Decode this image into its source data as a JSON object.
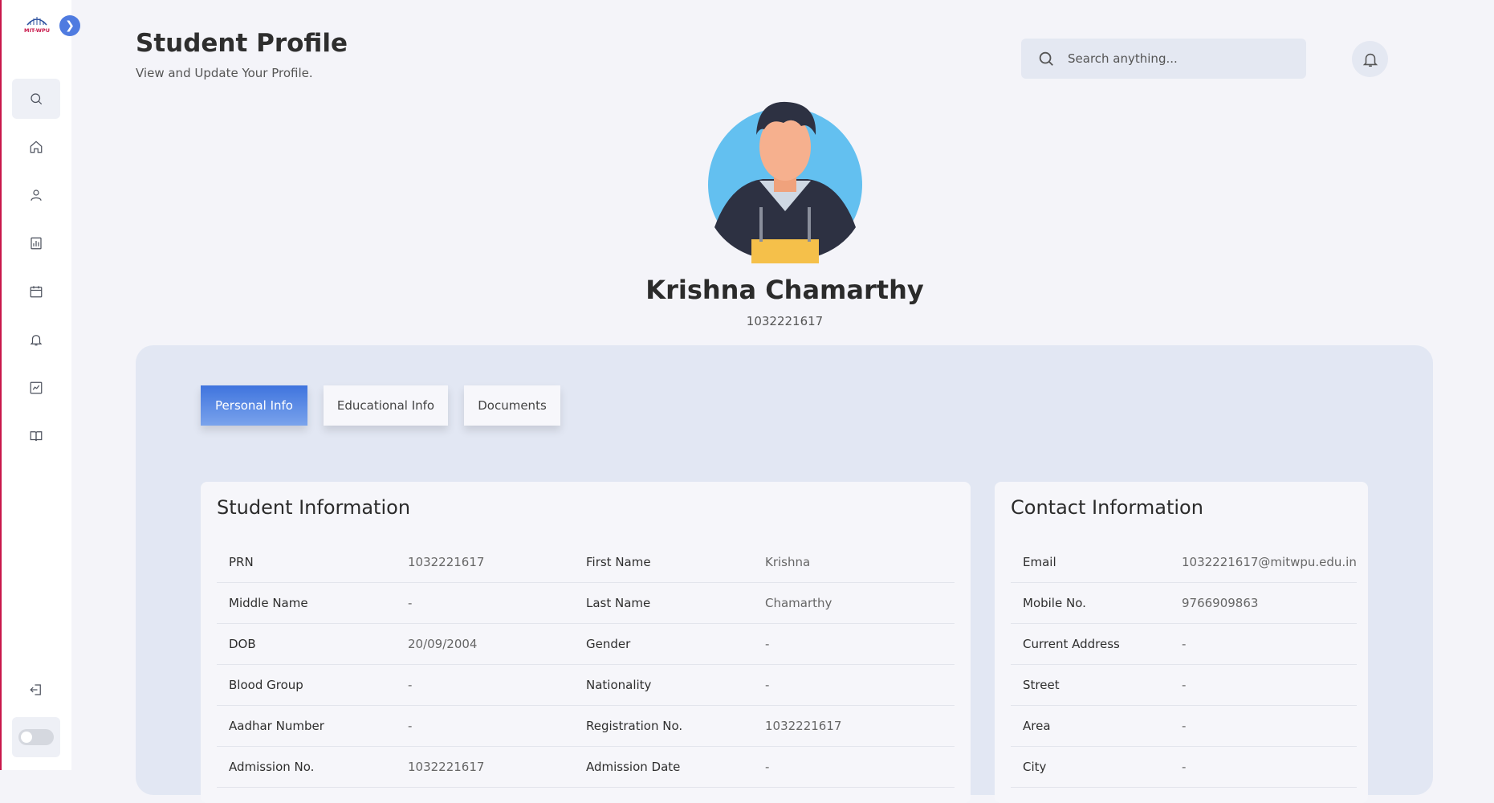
{
  "header": {
    "title": "Student Profile",
    "subtitle": "View and Update Your Profile.",
    "search_placeholder": "Search anything..."
  },
  "sidebar": {
    "logo_text": "MIT-WPU",
    "items": [
      "search-icon",
      "home-icon",
      "user-icon",
      "report-icon",
      "calendar-icon",
      "bell-icon",
      "chart-icon",
      "book-icon"
    ],
    "logout_icon": "logout-icon"
  },
  "profile": {
    "name": "Krishna Chamarthy",
    "prn": "1032221617"
  },
  "tabs": [
    {
      "label": "Personal Info",
      "active": true
    },
    {
      "label": "Educational Info",
      "active": false
    },
    {
      "label": "Documents",
      "active": false
    }
  ],
  "student_info": {
    "title": "Student Information",
    "rows": [
      [
        {
          "k": "PRN",
          "v": "1032221617"
        },
        {
          "k": "First Name",
          "v": "Krishna"
        }
      ],
      [
        {
          "k": "Middle Name",
          "v": "-"
        },
        {
          "k": "Last Name",
          "v": "Chamarthy"
        }
      ],
      [
        {
          "k": "DOB",
          "v": "20/09/2004"
        },
        {
          "k": "Gender",
          "v": "-"
        }
      ],
      [
        {
          "k": "Blood Group",
          "v": "-"
        },
        {
          "k": "Nationality",
          "v": "-"
        }
      ],
      [
        {
          "k": "Aadhar Number",
          "v": "-"
        },
        {
          "k": "Registration No.",
          "v": "1032221617"
        }
      ],
      [
        {
          "k": "Admission No.",
          "v": "1032221617"
        },
        {
          "k": "Admission Date",
          "v": "-"
        }
      ]
    ]
  },
  "contact_info": {
    "title": "Contact Information",
    "rows": [
      {
        "k": "Email",
        "v": "1032221617@mitwpu.edu.in"
      },
      {
        "k": "Mobile No.",
        "v": "9766909863"
      },
      {
        "k": "Current Address",
        "v": "-"
      },
      {
        "k": "Street",
        "v": "-"
      },
      {
        "k": "Area",
        "v": "-"
      },
      {
        "k": "City",
        "v": "-"
      }
    ]
  },
  "colors": {
    "accent": "#3f74de",
    "panel": "#e2e7f3",
    "background": "#f4f4f9"
  }
}
